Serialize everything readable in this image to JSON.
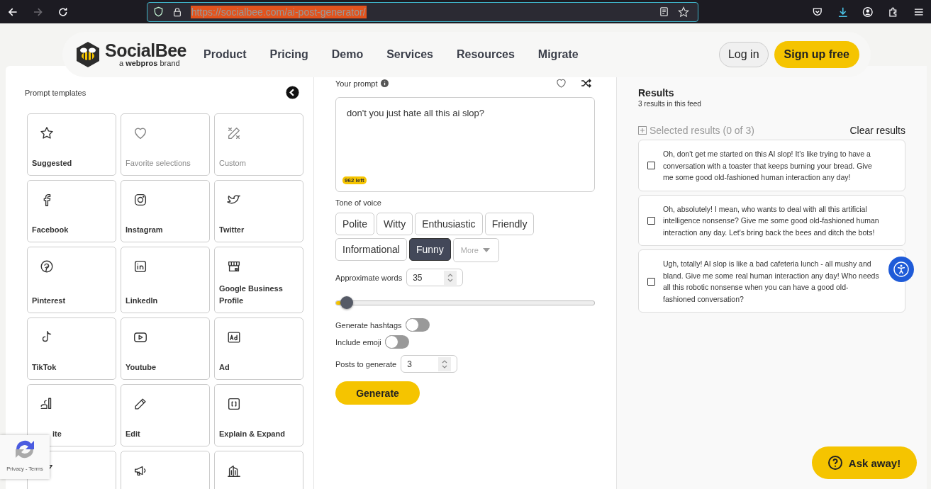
{
  "browser": {
    "url": "https://socialbee.com/ai-post-generator/",
    "url_selected": true,
    "back_disabled": false,
    "forward_disabled": true
  },
  "nav": {
    "brand": "SocialBee",
    "tagline": "a **webpros** brand",
    "items": [
      "Product",
      "Pricing",
      "Demo",
      "Services",
      "Resources",
      "Migrate"
    ],
    "login": "Log in",
    "signup": "Sign up free"
  },
  "templates": {
    "title": "Prompt templates",
    "tiles": [
      {
        "label": "Suggested",
        "disabled": false
      },
      {
        "label": "Favorite selections",
        "disabled": true
      },
      {
        "label": "Custom",
        "disabled": true
      },
      {
        "label": "Facebook",
        "disabled": false
      },
      {
        "label": "Instagram",
        "disabled": false
      },
      {
        "label": "Twitter",
        "disabled": false
      },
      {
        "label": "Pinterest",
        "disabled": false
      },
      {
        "label": "LinkedIn",
        "disabled": false
      },
      {
        "label": "Google Business Profile",
        "disabled": false
      },
      {
        "label": "TikTok",
        "disabled": false
      },
      {
        "label": "Youtube",
        "disabled": false
      },
      {
        "label": "Ad",
        "disabled": false
      },
      {
        "label": "ite",
        "disabled": false
      },
      {
        "label": "Edit",
        "disabled": false
      },
      {
        "label": "Explain & Expand",
        "disabled": false
      },
      {
        "disabled": false
      },
      {
        "disabled": false
      },
      {
        "disabled": false
      }
    ]
  },
  "prompt": {
    "label": "Your prompt",
    "value": "don't you just hate all this ai slop?",
    "chars_left": "962 left"
  },
  "tone": {
    "label": "Tone of voice",
    "options": [
      {
        "label": "Polite",
        "selected": false
      },
      {
        "label": "Witty",
        "selected": false
      },
      {
        "label": "Enthusiastic",
        "selected": false
      },
      {
        "label": "Friendly",
        "selected": false
      },
      {
        "label": "Informational",
        "selected": false
      },
      {
        "label": "Funny",
        "selected": true
      }
    ],
    "more": "More"
  },
  "words": {
    "label": "Approximate words",
    "value": "35",
    "level": 0.02
  },
  "hashtags": {
    "label": "Generate hashtags",
    "on": false
  },
  "emoji": {
    "label": "Include emoji",
    "on": false
  },
  "posts": {
    "label": "Posts to generate",
    "value": "3"
  },
  "generate": "Generate",
  "results": {
    "title": "Results",
    "subtitle": "3 results in this feed",
    "selected_label": "Selected results (0 of 3)",
    "clear": "Clear results",
    "items": [
      {
        "text": "Oh, don't get me started on this AI slop! It's like trying to have a conversation with a toaster that keeps burning your bread. Give me some good old-fashioned human interaction any day!",
        "checked": false
      },
      {
        "text": "Oh, absolutely! I mean, who wants to deal with all this artificial intelligence nonsense? Give me some good old-fashioned human interaction any day. Let's bring back the bees and ditch the bots!",
        "checked": false
      },
      {
        "text": "Ugh, totally! AI slop is like a bad cafeteria lunch - all mushy and bland. Give me some real human interaction any day! Who needs all this robotic nonsense when you can have a good old-fashioned conversation?",
        "checked": false
      }
    ]
  },
  "recaptcha": {
    "links": "Privacy - Terms"
  },
  "help": "Ask away!"
}
